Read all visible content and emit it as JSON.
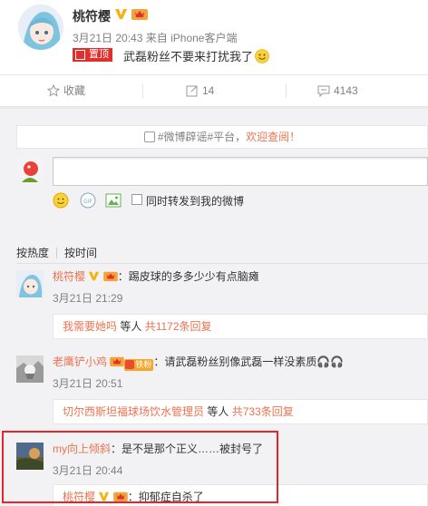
{
  "post": {
    "author": "桃符樱",
    "date": "3月21日 20:43",
    "source_prefix": "来自",
    "source": "iPhone客户端",
    "pinned_label": "置顶",
    "text": "武磊粉丝不要来打扰我了"
  },
  "actions": {
    "favorite_label": "收藏",
    "repost_count": "14",
    "comment_count": "4143"
  },
  "notice": {
    "prefix": "#微博辟谣#平台，",
    "link": "欢迎查阅！"
  },
  "composer": {
    "input_value": "",
    "repost_label": "同时转发到我的微博"
  },
  "sort": {
    "hot": "按热度",
    "time": "按时间"
  },
  "comments": [
    {
      "name": "桃符樱",
      "text": "：踢皮球的多多少少有点脑瘫",
      "time": "3月21日 21:29",
      "reply_user": "我需要她吗",
      "reply_mid": " 等人 ",
      "reply_count": "共1172条回复"
    },
    {
      "name": "老鹰铲小鸡",
      "badge": "铁粉",
      "text": "：请武磊粉丝别像武磊一样没素质🎧🎧",
      "time": "3月21日 20:51",
      "reply_user": "切尔西斯坦福球场饮水管理员",
      "reply_mid": " 等人 ",
      "reply_count": "共733条回复"
    },
    {
      "name": "my向上倾斜",
      "text": "：是不是那个正义……被封号了",
      "time": "3月21日 20:44",
      "reply_user": "桃符樱",
      "reply_text": "：抑郁症自杀了"
    }
  ],
  "colors": {
    "accent": "#eb7350",
    "pinned": "#e0302e",
    "highlight_box": "#e2262b"
  }
}
